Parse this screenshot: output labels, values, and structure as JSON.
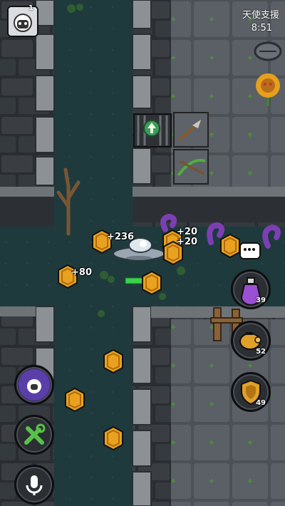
{
  "hud": {
    "level": "1",
    "support_label": "天使支援",
    "time": "8:51"
  },
  "gains": [
    "+236",
    "+80",
    "+20",
    "+20"
  ],
  "items": {
    "potion": "39",
    "piggy": "52",
    "shield": "49"
  },
  "icons": {
    "avatar": "sheep-face-icon",
    "support": "angel-support",
    "chat": "chat-bubble-icon",
    "potion": "potion-icon",
    "piggy": "piggy-bank-icon",
    "shield": "shield-icon",
    "skill": "ghost-sheep-icon",
    "tools": "tools-icon",
    "voice": "microphone-icon"
  },
  "colors": {
    "coin": "#e9a21f",
    "coin_rim": "#b06a0f",
    "health": "#3ad34a",
    "tentacle": "#7b3fb3"
  }
}
